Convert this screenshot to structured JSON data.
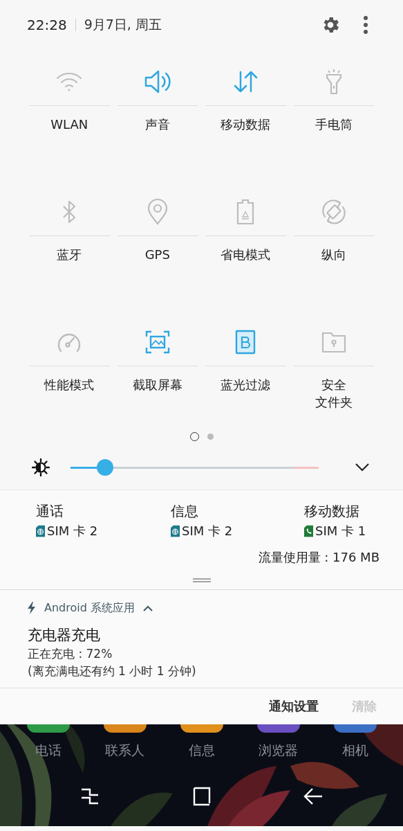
{
  "status_header": {
    "time": "22:28",
    "date": "9月7日, 周五"
  },
  "quick_tiles": [
    {
      "label": "WLAN",
      "on": false
    },
    {
      "label": "声音",
      "on": true
    },
    {
      "label": "移动数据",
      "on": true
    },
    {
      "label": "手电筒",
      "on": false
    },
    {
      "label": "蓝牙",
      "on": false
    },
    {
      "label": "GPS",
      "on": false
    },
    {
      "label": "省电模式",
      "on": false
    },
    {
      "label": "纵向",
      "on": false
    },
    {
      "label": "性能模式",
      "on": false
    },
    {
      "label": "截取屏幕",
      "on": true
    },
    {
      "label": "蓝光过滤",
      "on": true
    },
    {
      "label": "安全",
      "label_line_2": "文件夹",
      "on": false
    }
  ],
  "pages": [
    {
      "selected": true
    },
    {
      "selected": false
    }
  ],
  "brightness": {
    "level": 0.14
  },
  "sim_settings": [
    {
      "title": "通话",
      "kind": "data",
      "sim": "SIM 卡 2"
    },
    {
      "title": "信息",
      "kind": "data",
      "sim": "SIM 卡 2"
    },
    {
      "title": "移动数据",
      "kind": "call",
      "sim": "SIM 卡 1"
    }
  ],
  "data_usage": "流量使用量 : 176 MB",
  "notification": {
    "app": "Android 系统应用",
    "expanded": true,
    "title": "充电器充电",
    "lines": [
      "正在充电 : 72%",
      "(离充满电还有约 1 小时 1 分钟)"
    ]
  },
  "actions": [
    {
      "label": "通知设置",
      "disabled": false
    },
    {
      "label": "清除",
      "disabled": true
    }
  ],
  "dock": [
    {
      "label": "电话",
      "color": "#2e9a48"
    },
    {
      "label": "联系人",
      "color": "#d9861c"
    },
    {
      "label": "信息",
      "color": "#e0901c"
    },
    {
      "label": "浏览器",
      "color": "#6a4fc0"
    },
    {
      "label": "相机",
      "color": "#3b6fc4"
    }
  ]
}
